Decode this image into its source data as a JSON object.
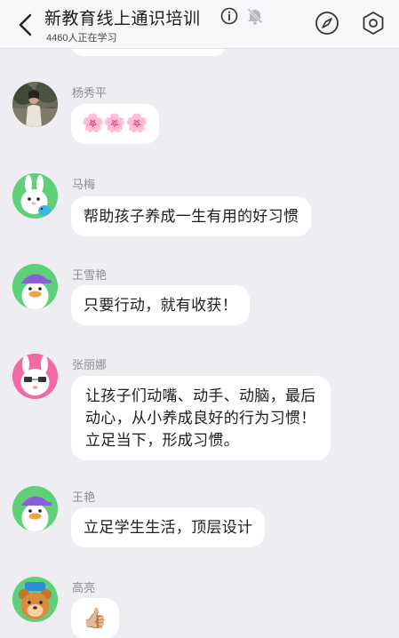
{
  "header": {
    "title": "新教育线上通识培训",
    "subtitle": "4460人正在学习"
  },
  "messages": [
    {
      "name": "杨秀平",
      "text": "🌸🌸🌸",
      "avatar_icon": "photo-avatar"
    },
    {
      "name": "马梅",
      "text": "帮助孩子养成一生有用的好习惯",
      "avatar_icon": "rabbit-avatar"
    },
    {
      "name": "王雪艳",
      "text": "只要行动，就有收获！",
      "avatar_icon": "duck-avatar"
    },
    {
      "name": "张丽娜",
      "text": "让孩子们动嘴、动手、动脑，最后\n动心，从小养成良好的行为习惯！\n立足当下，形成习惯。",
      "avatar_icon": "pink-rabbit-avatar"
    },
    {
      "name": "王艳",
      "text": "立足学生生活，顶层设计",
      "avatar_icon": "duck-avatar"
    },
    {
      "name": "高亮",
      "text": "👍🏼",
      "avatar_icon": "bear-avatar"
    }
  ],
  "colors": {
    "background": "#eeeef2",
    "bubble": "#ffffff",
    "name_text": "#8d8d93",
    "avatar_green": "#5fd07a",
    "avatar_pink": "#f06aa6"
  }
}
